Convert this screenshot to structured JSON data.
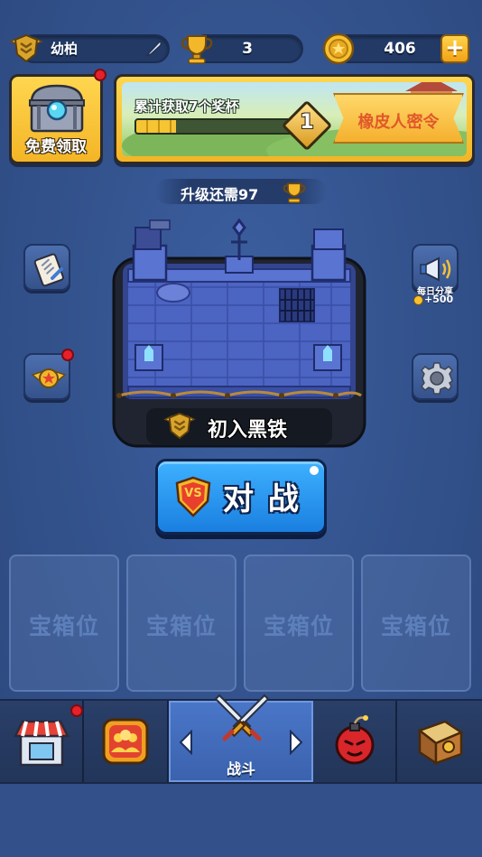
{
  "header": {
    "player_name": "幼柏",
    "trophies": "3",
    "coins": "406",
    "add_label": "+"
  },
  "free_chest": {
    "label": "免费领取"
  },
  "banner": {
    "task_text": "累计获取7个奖杯",
    "progress": 0.25,
    "level": "1",
    "pass_label": "橡皮人密令"
  },
  "upgrade": {
    "text": "升级还需97"
  },
  "rank": {
    "name": "初入黑铁"
  },
  "side": {
    "daily_share": "每日分享",
    "share_reward": "+500"
  },
  "battle": {
    "label": "对 战",
    "vs": "VS"
  },
  "chest_slots": [
    "宝箱位",
    "宝箱位",
    "宝箱位",
    "宝箱位"
  ],
  "nav": {
    "battle_label": "战斗"
  },
  "colors": {
    "accent_gold": "#f7c233",
    "battle_blue": "#1f8fe6",
    "badge_red": "#e8202a"
  }
}
